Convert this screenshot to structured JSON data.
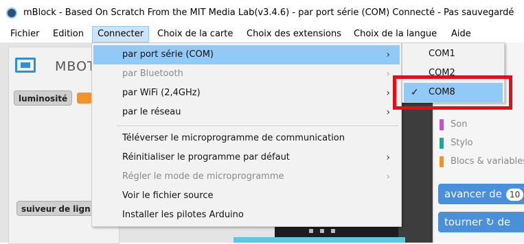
{
  "window": {
    "title": "mBlock - Based On Scratch From the MIT Media Lab(v3.4.6) - par port série (COM) Connecté - Pas sauvegardé"
  },
  "menubar": {
    "items": [
      "Fichier",
      "Edition",
      "Connecter",
      "Choix de la carte",
      "Choix des extensions",
      "Choix de la langue",
      "Aide"
    ],
    "active": "Connecter"
  },
  "left_panel": {
    "device_label": "MBOT",
    "blocks": [
      "luminosité",
      "suiveur de lign"
    ]
  },
  "connect_menu": {
    "items": [
      {
        "label": "par port série (COM)",
        "submenu": true,
        "enabled": true,
        "highlighted": true
      },
      {
        "label": "par Bluetooth",
        "submenu": true,
        "enabled": false
      },
      {
        "label": "par WiFi (2,4GHz)",
        "submenu": true,
        "enabled": true
      },
      {
        "label": "par le réseau",
        "submenu": true,
        "enabled": true
      },
      {
        "label": "Téléverser le microprogramme de communication",
        "submenu": false,
        "enabled": true
      },
      {
        "label": "Réinitialiser le programme par défaut",
        "submenu": true,
        "enabled": true
      },
      {
        "label": "Régler le mode de microprogramme",
        "submenu": true,
        "enabled": false
      },
      {
        "label": "Voir le fichier source",
        "submenu": false,
        "enabled": true
      },
      {
        "label": "Installer les pilotes Arduino",
        "submenu": false,
        "enabled": true
      }
    ],
    "arrow_glyph": "›"
  },
  "port_submenu": {
    "items": [
      {
        "label": "COM1",
        "checked": false
      },
      {
        "label": "COM2",
        "checked": false
      },
      {
        "label": "COM8",
        "checked": true
      }
    ],
    "check_glyph": "✓"
  },
  "categories": {
    "items": [
      {
        "label": "Son",
        "color": "#c94fd0"
      },
      {
        "label": "Stylo",
        "color": "#1fa896"
      },
      {
        "label": "Blocs & variables",
        "color": "#f0922e"
      }
    ]
  },
  "motion_blocks": {
    "forward_label": "avancer de",
    "forward_value": "10",
    "turn_label": "tourner",
    "turn_suffix": "de",
    "turn_icon_glyph": "↻"
  },
  "colors": {
    "highlight": "#91c9f7",
    "menu_active": "#cce4f7",
    "annotation_red": "#e0101a",
    "motion_blue": "#4a8fd9"
  }
}
